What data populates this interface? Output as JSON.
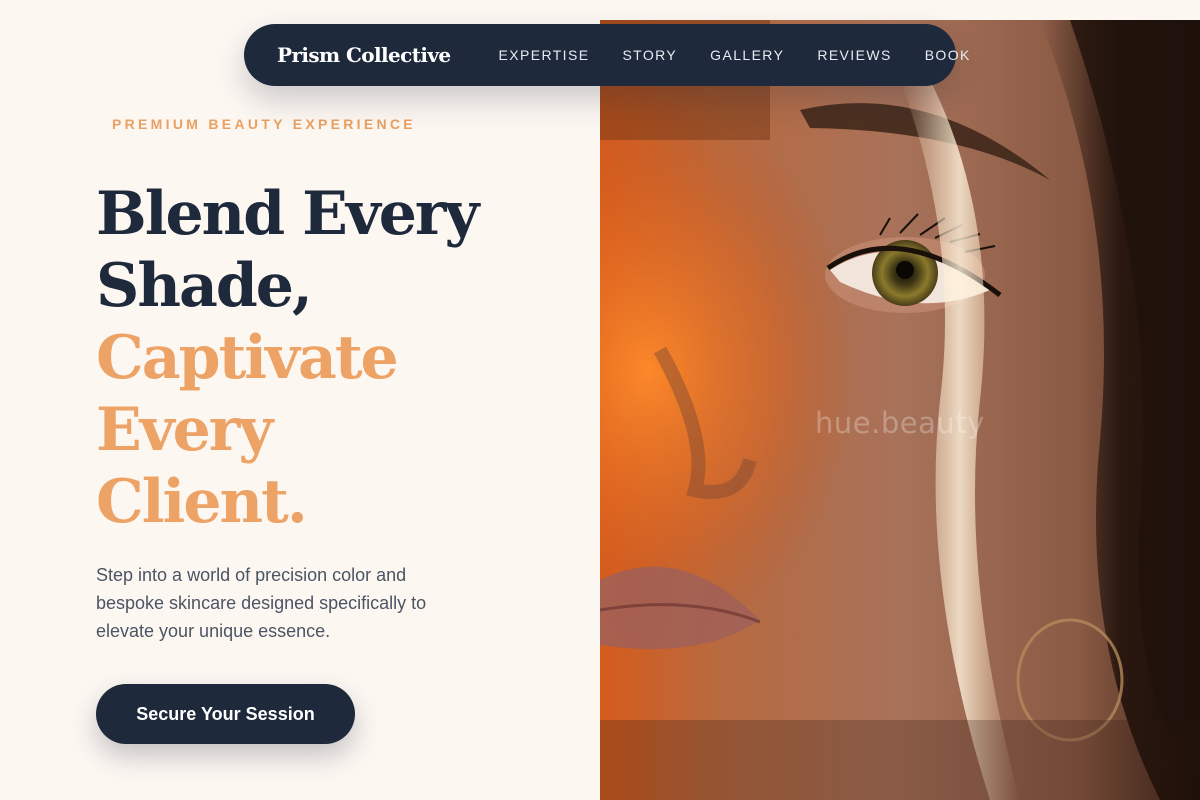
{
  "nav": {
    "brand": "Prism Collective",
    "links": [
      "EXPERTISE",
      "STORY",
      "GALLERY",
      "REVIEWS",
      "BOOK"
    ]
  },
  "hero": {
    "eyebrow": "PREMIUM BEAUTY EXPERIENCE",
    "headline_dark": [
      "Blend Every",
      "Shade,"
    ],
    "headline_accent": [
      "Captivate",
      "Every",
      "Client."
    ],
    "description": "Step into a world of precision color and bespoke skincare designed specifically to elevate your unique essence.",
    "cta_label": "Secure Your Session",
    "photo_watermark": "hue.beauty"
  },
  "colors": {
    "background": "#fdf7f2",
    "navy": "#1e293b",
    "accent": "#eda266",
    "body_text": "#4b5563"
  }
}
